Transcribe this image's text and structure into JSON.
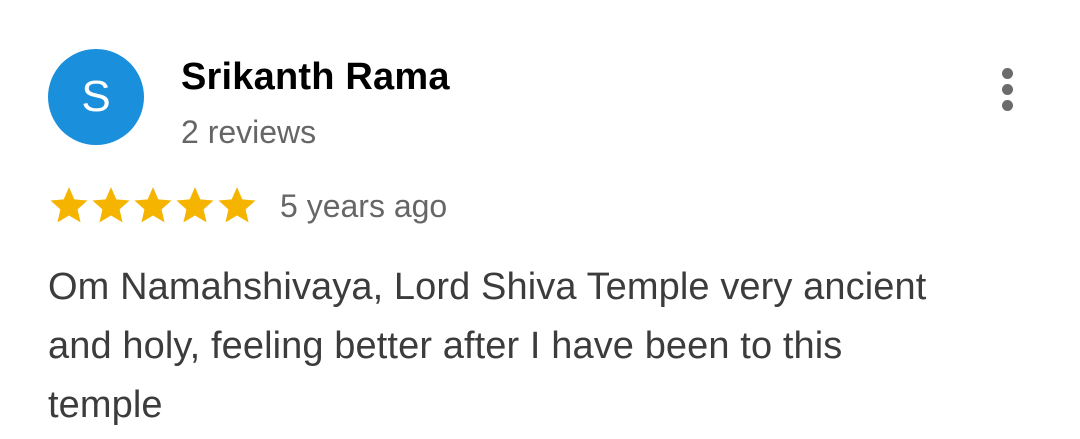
{
  "review": {
    "author": {
      "initial": "S",
      "name": "Srikanth Rama",
      "review_count": "2 reviews",
      "avatar_color": "#1a8fdb"
    },
    "rating": 5,
    "rating_max": 5,
    "star_color": "#f4b400",
    "date": "5 years ago",
    "text": "Om Namahshivaya, Lord Shiva Temple very ancient and holy, feeling better after I have been to this temple",
    "menu_icon": "more-vert-icon"
  }
}
